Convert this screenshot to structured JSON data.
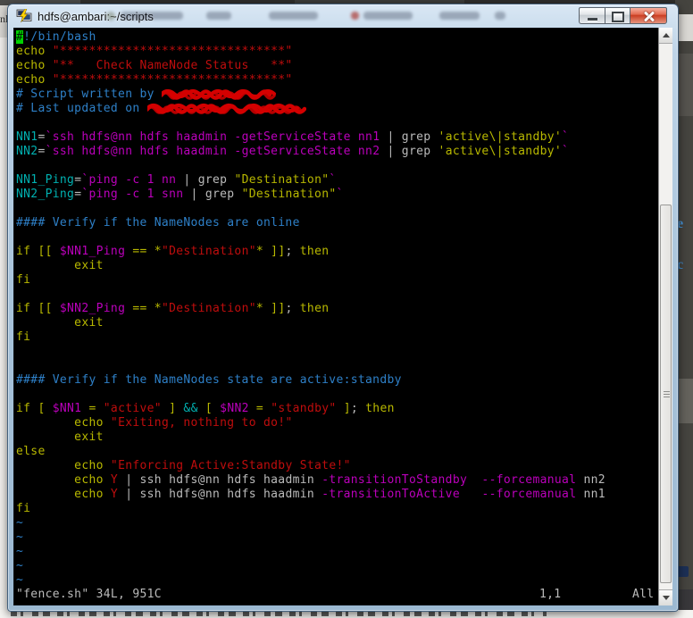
{
  "window": {
    "title": "hdfs@ambari:~/scripts"
  },
  "titlebar": {
    "buttons": [
      "minimize",
      "maximize",
      "close"
    ]
  },
  "palette": {
    "white": "#bbbbbb",
    "yellow": "#b8b800",
    "red": "#bf0d0d",
    "blue": "#2e80c8",
    "cyan": "#00b0b0",
    "magenta": "#bb00bb",
    "scribble": "#d40000",
    "cursor_bg": "#00d200",
    "cursor_fg": "#002200"
  },
  "background": {
    "left_fragment": "nl",
    "right_fragments": [
      "e",
      "c"
    ]
  },
  "terminal": {
    "rows": [
      [
        {
          "c": "cursor",
          "t": "#"
        },
        {
          "c": "blue",
          "t": "!/bin/bash"
        }
      ],
      [
        {
          "c": "yellow",
          "t": "echo "
        },
        {
          "c": "red",
          "t": "\"*******************************\""
        }
      ],
      [
        {
          "c": "yellow",
          "t": "echo "
        },
        {
          "c": "red",
          "t": "\"**   Check NameNode Status   **\""
        }
      ],
      [
        {
          "c": "yellow",
          "t": "echo "
        },
        {
          "c": "red",
          "t": "\"*******************************\""
        }
      ],
      [
        {
          "c": "blue",
          "t": "# Script written by "
        },
        {
          "scribble": true,
          "w": 130
        }
      ],
      [
        {
          "c": "blue",
          "t": "# Last updated on "
        },
        {
          "scribble": true,
          "w": 178
        }
      ],
      [],
      [
        {
          "c": "cyan",
          "t": "NN1"
        },
        {
          "c": "white",
          "t": "="
        },
        {
          "c": "magenta",
          "t": "`ssh hdfs@nn hdfs haadmin -getServiceState nn1"
        },
        {
          "c": "white",
          "t": " | grep "
        },
        {
          "c": "yellow",
          "t": "'active\\|standby'"
        },
        {
          "c": "magenta",
          "t": "`"
        }
      ],
      [
        {
          "c": "cyan",
          "t": "NN2"
        },
        {
          "c": "white",
          "t": "="
        },
        {
          "c": "magenta",
          "t": "`ssh hdfs@nn hdfs haadmin -getServiceState nn2"
        },
        {
          "c": "white",
          "t": " | grep "
        },
        {
          "c": "yellow",
          "t": "'active\\|standby'"
        },
        {
          "c": "magenta",
          "t": "`"
        }
      ],
      [],
      [
        {
          "c": "cyan",
          "t": "NN1_Ping"
        },
        {
          "c": "white",
          "t": "="
        },
        {
          "c": "magenta",
          "t": "`ping -c 1 nn"
        },
        {
          "c": "white",
          "t": " | grep "
        },
        {
          "c": "yellow",
          "t": "\"Destination\""
        },
        {
          "c": "magenta",
          "t": "`"
        }
      ],
      [
        {
          "c": "cyan",
          "t": "NN2_Ping"
        },
        {
          "c": "white",
          "t": "="
        },
        {
          "c": "magenta",
          "t": "`ping -c 1 snn"
        },
        {
          "c": "white",
          "t": " | grep "
        },
        {
          "c": "yellow",
          "t": "\"Destination\""
        },
        {
          "c": "magenta",
          "t": "`"
        }
      ],
      [],
      [
        {
          "c": "blue",
          "t": "#### Verify if the NameNodes are online"
        }
      ],
      [],
      [
        {
          "c": "yellow",
          "t": "if [[ "
        },
        {
          "c": "magenta",
          "t": "$NN1_Ping"
        },
        {
          "c": "yellow",
          "t": " == *"
        },
        {
          "c": "red",
          "t": "\"Destination\""
        },
        {
          "c": "yellow",
          "t": "* ]]"
        },
        {
          "c": "white",
          "t": ";"
        },
        {
          "c": "yellow",
          "t": " then"
        }
      ],
      [
        {
          "c": "yellow",
          "t": "        exit"
        }
      ],
      [
        {
          "c": "yellow",
          "t": "fi"
        }
      ],
      [],
      [
        {
          "c": "yellow",
          "t": "if [[ "
        },
        {
          "c": "magenta",
          "t": "$NN2_Ping"
        },
        {
          "c": "yellow",
          "t": " == *"
        },
        {
          "c": "red",
          "t": "\"Destination\""
        },
        {
          "c": "yellow",
          "t": "* ]]"
        },
        {
          "c": "white",
          "t": ";"
        },
        {
          "c": "yellow",
          "t": " then"
        }
      ],
      [
        {
          "c": "yellow",
          "t": "        exit"
        }
      ],
      [
        {
          "c": "yellow",
          "t": "fi"
        }
      ],
      [],
      [],
      [
        {
          "c": "blue",
          "t": "#### Verify if the NameNodes state are active:standby"
        }
      ],
      [],
      [
        {
          "c": "yellow",
          "t": "if [ "
        },
        {
          "c": "magenta",
          "t": "$NN1"
        },
        {
          "c": "yellow",
          "t": " = "
        },
        {
          "c": "red",
          "t": "\"active\""
        },
        {
          "c": "yellow",
          "t": " ] "
        },
        {
          "c": "cyan",
          "t": "&&"
        },
        {
          "c": "yellow",
          "t": " [ "
        },
        {
          "c": "magenta",
          "t": "$NN2"
        },
        {
          "c": "yellow",
          "t": " = "
        },
        {
          "c": "red",
          "t": "\"standby\""
        },
        {
          "c": "yellow",
          "t": " ]"
        },
        {
          "c": "white",
          "t": ";"
        },
        {
          "c": "yellow",
          "t": " then"
        }
      ],
      [
        {
          "c": "yellow",
          "t": "        echo "
        },
        {
          "c": "red",
          "t": "\"Exiting, nothing to do!\""
        }
      ],
      [
        {
          "c": "yellow",
          "t": "        exit"
        }
      ],
      [
        {
          "c": "yellow",
          "t": "else"
        }
      ],
      [
        {
          "c": "yellow",
          "t": "        echo "
        },
        {
          "c": "red",
          "t": "\"Enforcing Active:Standby State!\""
        }
      ],
      [
        {
          "c": "yellow",
          "t": "        echo "
        },
        {
          "c": "red",
          "t": "Y"
        },
        {
          "c": "white",
          "t": " | ssh hdfs@nn hdfs haadmin "
        },
        {
          "c": "magenta",
          "t": "-transitionToStandby"
        },
        {
          "c": "white",
          "t": "  "
        },
        {
          "c": "magenta",
          "t": "--forcemanual"
        },
        {
          "c": "white",
          "t": " nn2"
        }
      ],
      [
        {
          "c": "yellow",
          "t": "        echo "
        },
        {
          "c": "red",
          "t": "Y"
        },
        {
          "c": "white",
          "t": " | ssh hdfs@nn hdfs haadmin "
        },
        {
          "c": "magenta",
          "t": "-transitionToActive"
        },
        {
          "c": "white",
          "t": "   "
        },
        {
          "c": "magenta",
          "t": "--forcemanual"
        },
        {
          "c": "white",
          "t": " nn1"
        }
      ],
      [
        {
          "c": "yellow",
          "t": "fi"
        }
      ],
      [
        {
          "c": "blue",
          "t": "~"
        }
      ],
      [
        {
          "c": "blue",
          "t": "~"
        }
      ],
      [
        {
          "c": "blue",
          "t": "~"
        }
      ],
      [
        {
          "c": "blue",
          "t": "~"
        }
      ],
      [
        {
          "c": "blue",
          "t": "~"
        }
      ]
    ],
    "status": {
      "left": "\"fence.sh\" 34L, 951C",
      "ruler": "1,1",
      "scroll": "All"
    }
  }
}
